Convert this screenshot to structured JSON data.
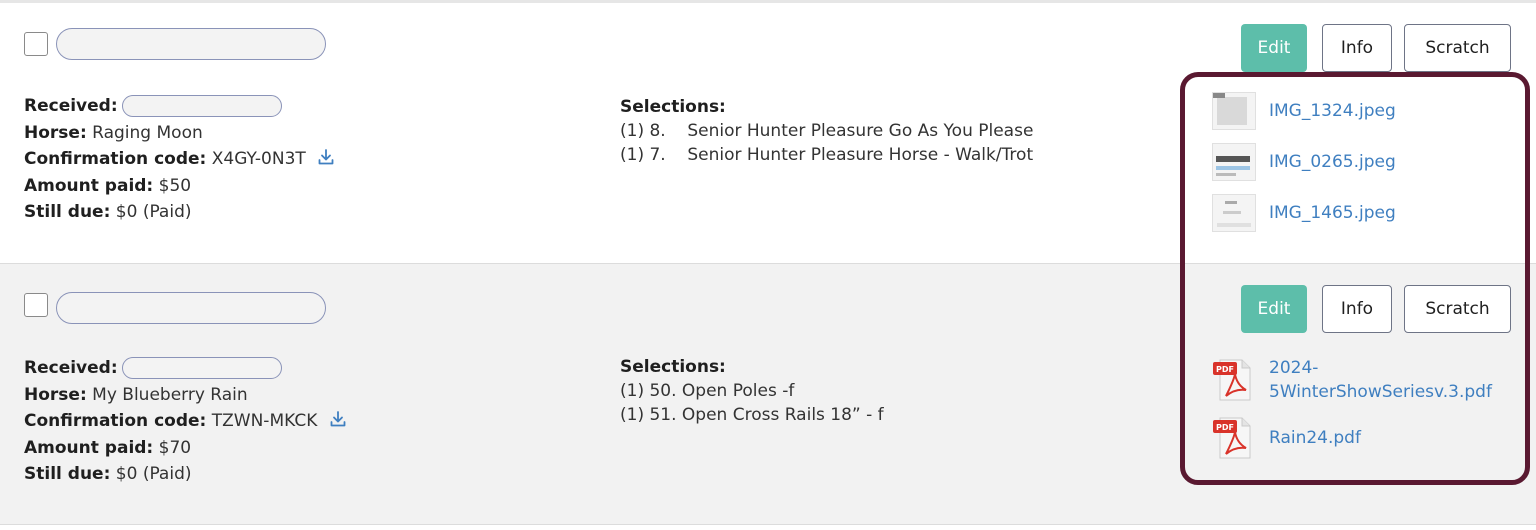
{
  "entries": [
    {
      "received_label": "Received:",
      "horse_label": "Horse:",
      "horse": "Raging Moon",
      "code_label": "Confirmation code:",
      "code": "X4GY-0N3T",
      "amount_label": "Amount paid:",
      "amount": "$50",
      "due_label": "Still due:",
      "due": "$0 (Paid)",
      "selections_label": "Selections:",
      "selections": [
        "(1) 8.    Senior Hunter Pleasure Go As You Please",
        "(1) 7.    Senior Hunter Pleasure Horse - Walk/Trot"
      ],
      "buttons": {
        "edit": "Edit",
        "info": "Info",
        "scratch": "Scratch"
      },
      "files": [
        {
          "name": "IMG_1324.jpeg",
          "icon": "image-thumbnail"
        },
        {
          "name": "IMG_0265.jpeg",
          "icon": "image-thumbnail"
        },
        {
          "name": "IMG_1465.jpeg",
          "icon": "image-thumbnail"
        }
      ]
    },
    {
      "received_label": "Received:",
      "horse_label": "Horse:",
      "horse": "My Blueberry Rain",
      "code_label": "Confirmation code:",
      "code": "TZWN-MKCK",
      "amount_label": "Amount paid:",
      "amount": "$70",
      "due_label": "Still due:",
      "due": "$0 (Paid)",
      "selections_label": "Selections:",
      "selections": [
        "(1) 50. Open Poles -f",
        "(1) 51. Open Cross Rails 18” - f"
      ],
      "buttons": {
        "edit": "Edit",
        "info": "Info",
        "scratch": "Scratch"
      },
      "files": [
        {
          "name_line1": "2024-",
          "name_line2": "5WinterShowSeriesv.3.pdf",
          "icon": "pdf-icon"
        },
        {
          "name": "Rain24.pdf",
          "icon": "pdf-icon"
        }
      ]
    }
  ],
  "colors": {
    "accent": "#5dbeaa",
    "link": "#3f7fc0",
    "highlight_border": "#5a1931"
  }
}
